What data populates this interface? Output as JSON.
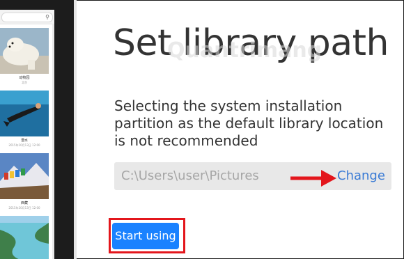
{
  "main": {
    "title": "Set library path",
    "watermark": "Quantrimang",
    "description": "Selecting the system installation partition as the default library location is not recommended",
    "path_value": "C:\\Users\\user\\Pictures",
    "change_label": "Change",
    "start_label": "Start using"
  },
  "preview": {
    "search_icon": "search-icon",
    "items": [
      {
        "caption": "动物园",
        "sub": "北京"
      },
      {
        "caption": "潜水",
        "sub": "2015年10月13日 12:00"
      },
      {
        "caption": "西藏",
        "sub": "2015年10月13日 12:00"
      },
      {
        "caption": "",
        "sub": ""
      }
    ]
  },
  "colors": {
    "accent": "#1a82ff",
    "link": "#3a7bd5",
    "annotation_red": "#e3161c",
    "dark_frame": "#1c1c1c"
  }
}
